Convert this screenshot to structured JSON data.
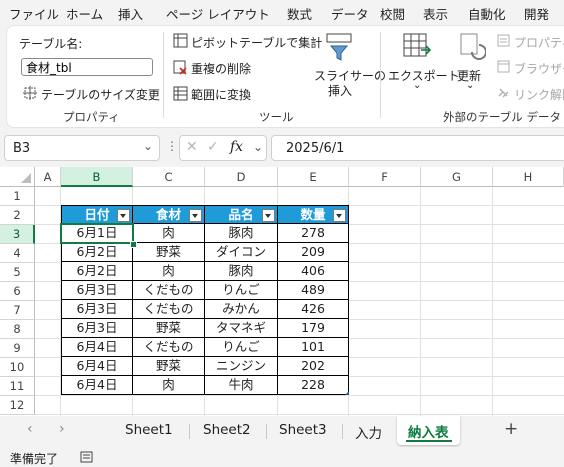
{
  "menu": [
    "ファイル",
    "ホーム",
    "挿入",
    "ページ レイアウト",
    "数式",
    "データ",
    "校閲",
    "表示",
    "自動化",
    "開発"
  ],
  "ribbon": {
    "table_name_label": "テーブル名:",
    "table_name_value": "食材_tbl",
    "resize_label": "テーブルのサイズ変更",
    "group_properties": "プロパティ",
    "pivot_label": "ピボットテーブルで集計",
    "remove_dup_label": "重複の削除",
    "convert_range_label": "範囲に変換",
    "slicer_label_1": "スライサーの",
    "slicer_label_2": "挿入",
    "group_tools": "ツール",
    "export_label": "エクスポート",
    "refresh_label": "更新",
    "prop_label": "プロパティ",
    "browser_label": "ブラウザー",
    "unlink_label": "リンク解除",
    "group_external": "外部のテーブル データ"
  },
  "formula_bar": {
    "name_box": "B3",
    "formula": "2025/6/1"
  },
  "columns": [
    "A",
    "B",
    "C",
    "D",
    "E",
    "F",
    "G",
    "H"
  ],
  "rows": [
    "1",
    "2",
    "3",
    "4",
    "5",
    "6",
    "7",
    "8",
    "9",
    "10",
    "11",
    "12"
  ],
  "table": {
    "headers": [
      "日付",
      "食材",
      "品名",
      "数量"
    ],
    "rows": [
      [
        "6月1日",
        "肉",
        "豚肉",
        "278"
      ],
      [
        "6月2日",
        "野菜",
        "ダイコン",
        "209"
      ],
      [
        "6月2日",
        "肉",
        "豚肉",
        "406"
      ],
      [
        "6月3日",
        "くだもの",
        "りんご",
        "489"
      ],
      [
        "6月3日",
        "くだもの",
        "みかん",
        "426"
      ],
      [
        "6月3日",
        "野菜",
        "タマネギ",
        "179"
      ],
      [
        "6月4日",
        "くだもの",
        "りんご",
        "101"
      ],
      [
        "6月4日",
        "野菜",
        "ニンジン",
        "202"
      ],
      [
        "6月4日",
        "肉",
        "牛肉",
        "228"
      ]
    ]
  },
  "sheets": [
    "Sheet1",
    "Sheet2",
    "Sheet3",
    "入力",
    "納入表"
  ],
  "active_sheet": "納入表",
  "status": "準備完了",
  "colors": {
    "accent": "#107c41",
    "table_header": "#1f9bd8"
  }
}
